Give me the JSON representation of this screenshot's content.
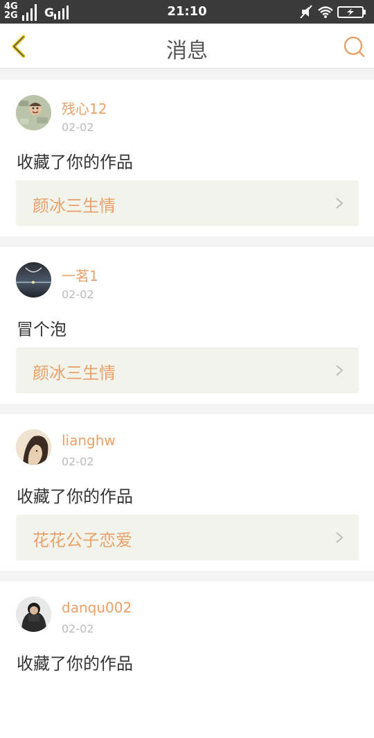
{
  "status_bar": {
    "network_top": "4G",
    "network_bottom": "2G",
    "carrier_label": "G",
    "time": "21:10"
  },
  "header": {
    "title": "消息",
    "back_icon": "chevron-left-icon",
    "search_icon": "search-icon"
  },
  "colors": {
    "accent": "#e8a16b",
    "back_arrow": "#e2c11a",
    "card_link_bg": "#f2f3ea",
    "page_bg": "#f3f3f3"
  },
  "messages": [
    {
      "user": "残心12",
      "date": "02-02",
      "action": "收藏了你的作品",
      "work": "颜冰三生情"
    },
    {
      "user": "一茗1",
      "date": "02-02",
      "action": "冒个泡",
      "work": "颜冰三生情"
    },
    {
      "user": "lianghw",
      "date": "02-02",
      "action": "收藏了你的作品",
      "work": "花花公子恋爱"
    },
    {
      "user": "danqu002",
      "date": "02-02",
      "action": "收藏了你的作品",
      "work": ""
    }
  ]
}
